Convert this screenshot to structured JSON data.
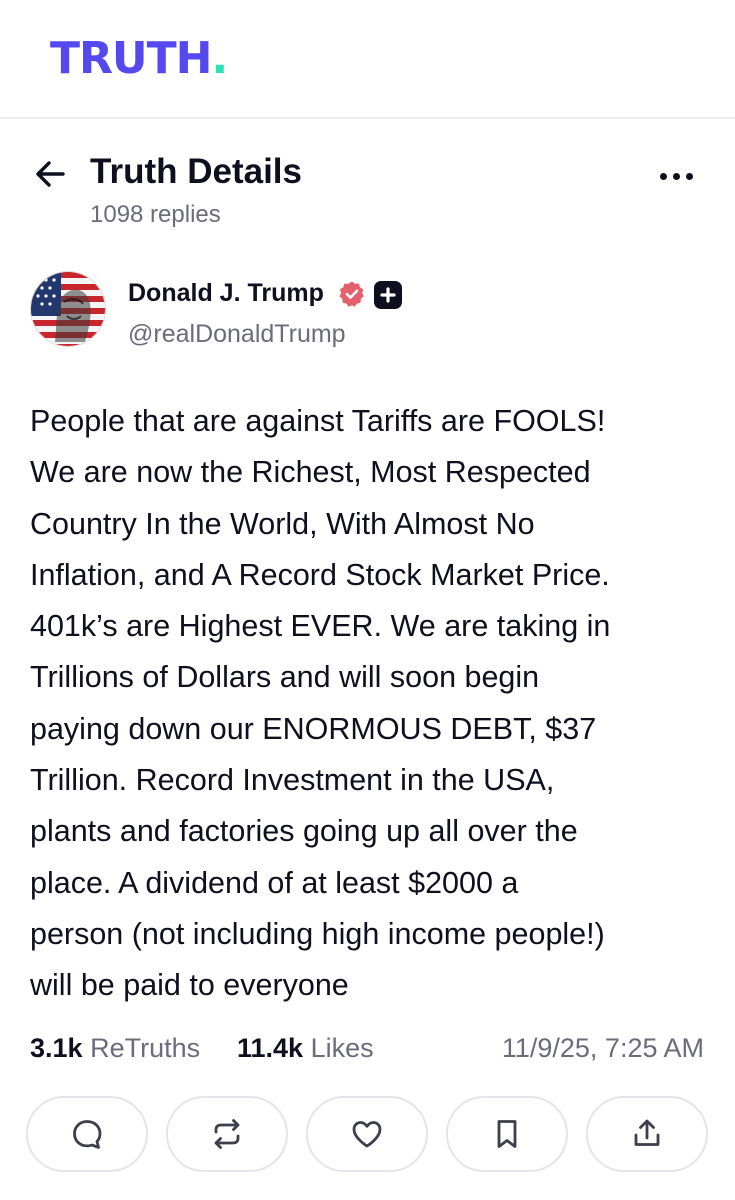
{
  "app": {
    "logo_text": "TRUTH",
    "logo_dot": "."
  },
  "header": {
    "title": "Truth Details",
    "replies_text": "1098 replies",
    "back_icon": "arrow-left-icon",
    "more_icon": "more-horizontal-icon"
  },
  "author": {
    "name": "Donald J. Trump",
    "handle": "@realDonaldTrump",
    "verified_icon": "verified-badge-icon",
    "plus_icon": "plus-badge-icon"
  },
  "post": {
    "text": "People that are against Tariffs are FOOLS!\nWe are now the Richest, Most Respected\nCountry In the World, With Almost No\nInflation, and A Record Stock Market Price.\n401k’s are Highest EVER. We are taking in\nTrillions of Dollars and will soon begin\npaying down our ENORMOUS DEBT, $37\nTrillion. Record Investment in the USA,\nplants and factories going up all over the\nplace. A dividend of at least $2000 a\nperson (not including high income people!)\nwill be paid to everyone"
  },
  "stats": {
    "retruths_count": "3.1k",
    "retruths_label": "ReTruths",
    "likes_count": "11.4k",
    "likes_label": "Likes",
    "timestamp": "11/9/25, 7:25 AM"
  },
  "actions": [
    {
      "icon": "reply-icon"
    },
    {
      "icon": "retruth-icon"
    },
    {
      "icon": "like-heart-icon"
    },
    {
      "icon": "bookmark-icon"
    },
    {
      "icon": "share-icon"
    }
  ],
  "colors": {
    "brand": "#5448ee",
    "brand_dot": "#2ee0b5",
    "verified": "#e4606d",
    "text": "#0f0f1f",
    "muted": "#6b6b7b",
    "border": "#e4e4ea"
  }
}
